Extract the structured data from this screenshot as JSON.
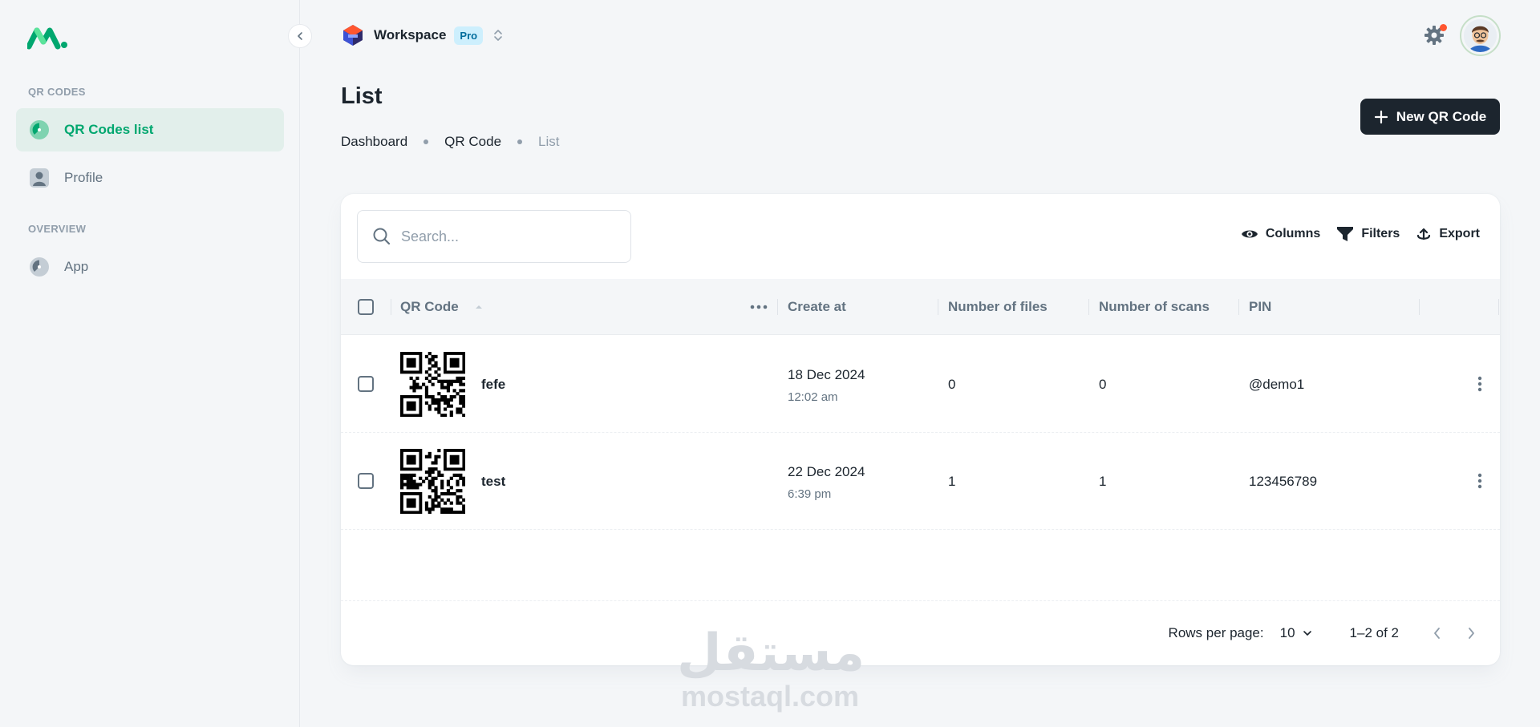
{
  "sidebar": {
    "sections": [
      {
        "subheader": "QR CODES",
        "items": [
          {
            "label": "QR Codes list",
            "icon": "dashboard-gauge-icon",
            "active": true
          },
          {
            "label": "Profile",
            "icon": "user-profile-icon",
            "active": false
          }
        ]
      },
      {
        "subheader": "OVERVIEW",
        "items": [
          {
            "label": "App",
            "icon": "dashboard-gauge-icon",
            "active": false
          }
        ]
      }
    ]
  },
  "header": {
    "workspace": {
      "name": "Workspace",
      "plan_badge": "Pro"
    }
  },
  "page": {
    "title": "List",
    "breadcrumbs": [
      "Dashboard",
      "QR Code",
      "List"
    ],
    "new_button_label": "New QR Code"
  },
  "table": {
    "search_placeholder": "Search...",
    "toolbar": {
      "columns": "Columns",
      "filters": "Filters",
      "export": "Export"
    },
    "columns": [
      "QR Code",
      "Create at",
      "Number of files",
      "Number of scans",
      "PIN"
    ],
    "rows": [
      {
        "name": "fefe",
        "date": "18 Dec 2024",
        "time": "12:02 am",
        "files": "0",
        "scans": "0",
        "pin": "@demo1"
      },
      {
        "name": "test",
        "date": "22 Dec 2024",
        "time": "6:39 pm",
        "files": "1",
        "scans": "1",
        "pin": "123456789"
      }
    ],
    "pagination": {
      "rows_per_page_label": "Rows per page:",
      "rows_per_page": "10",
      "range": "1–2 of 2"
    }
  },
  "watermark": {
    "arabic": "مستقل",
    "latin": "mostaql.com"
  },
  "colors": {
    "primary": "#00a76f",
    "active_bg": "#e2efeb",
    "dark": "#1c252e",
    "muted": "#637381",
    "notify": "#ff5630"
  }
}
